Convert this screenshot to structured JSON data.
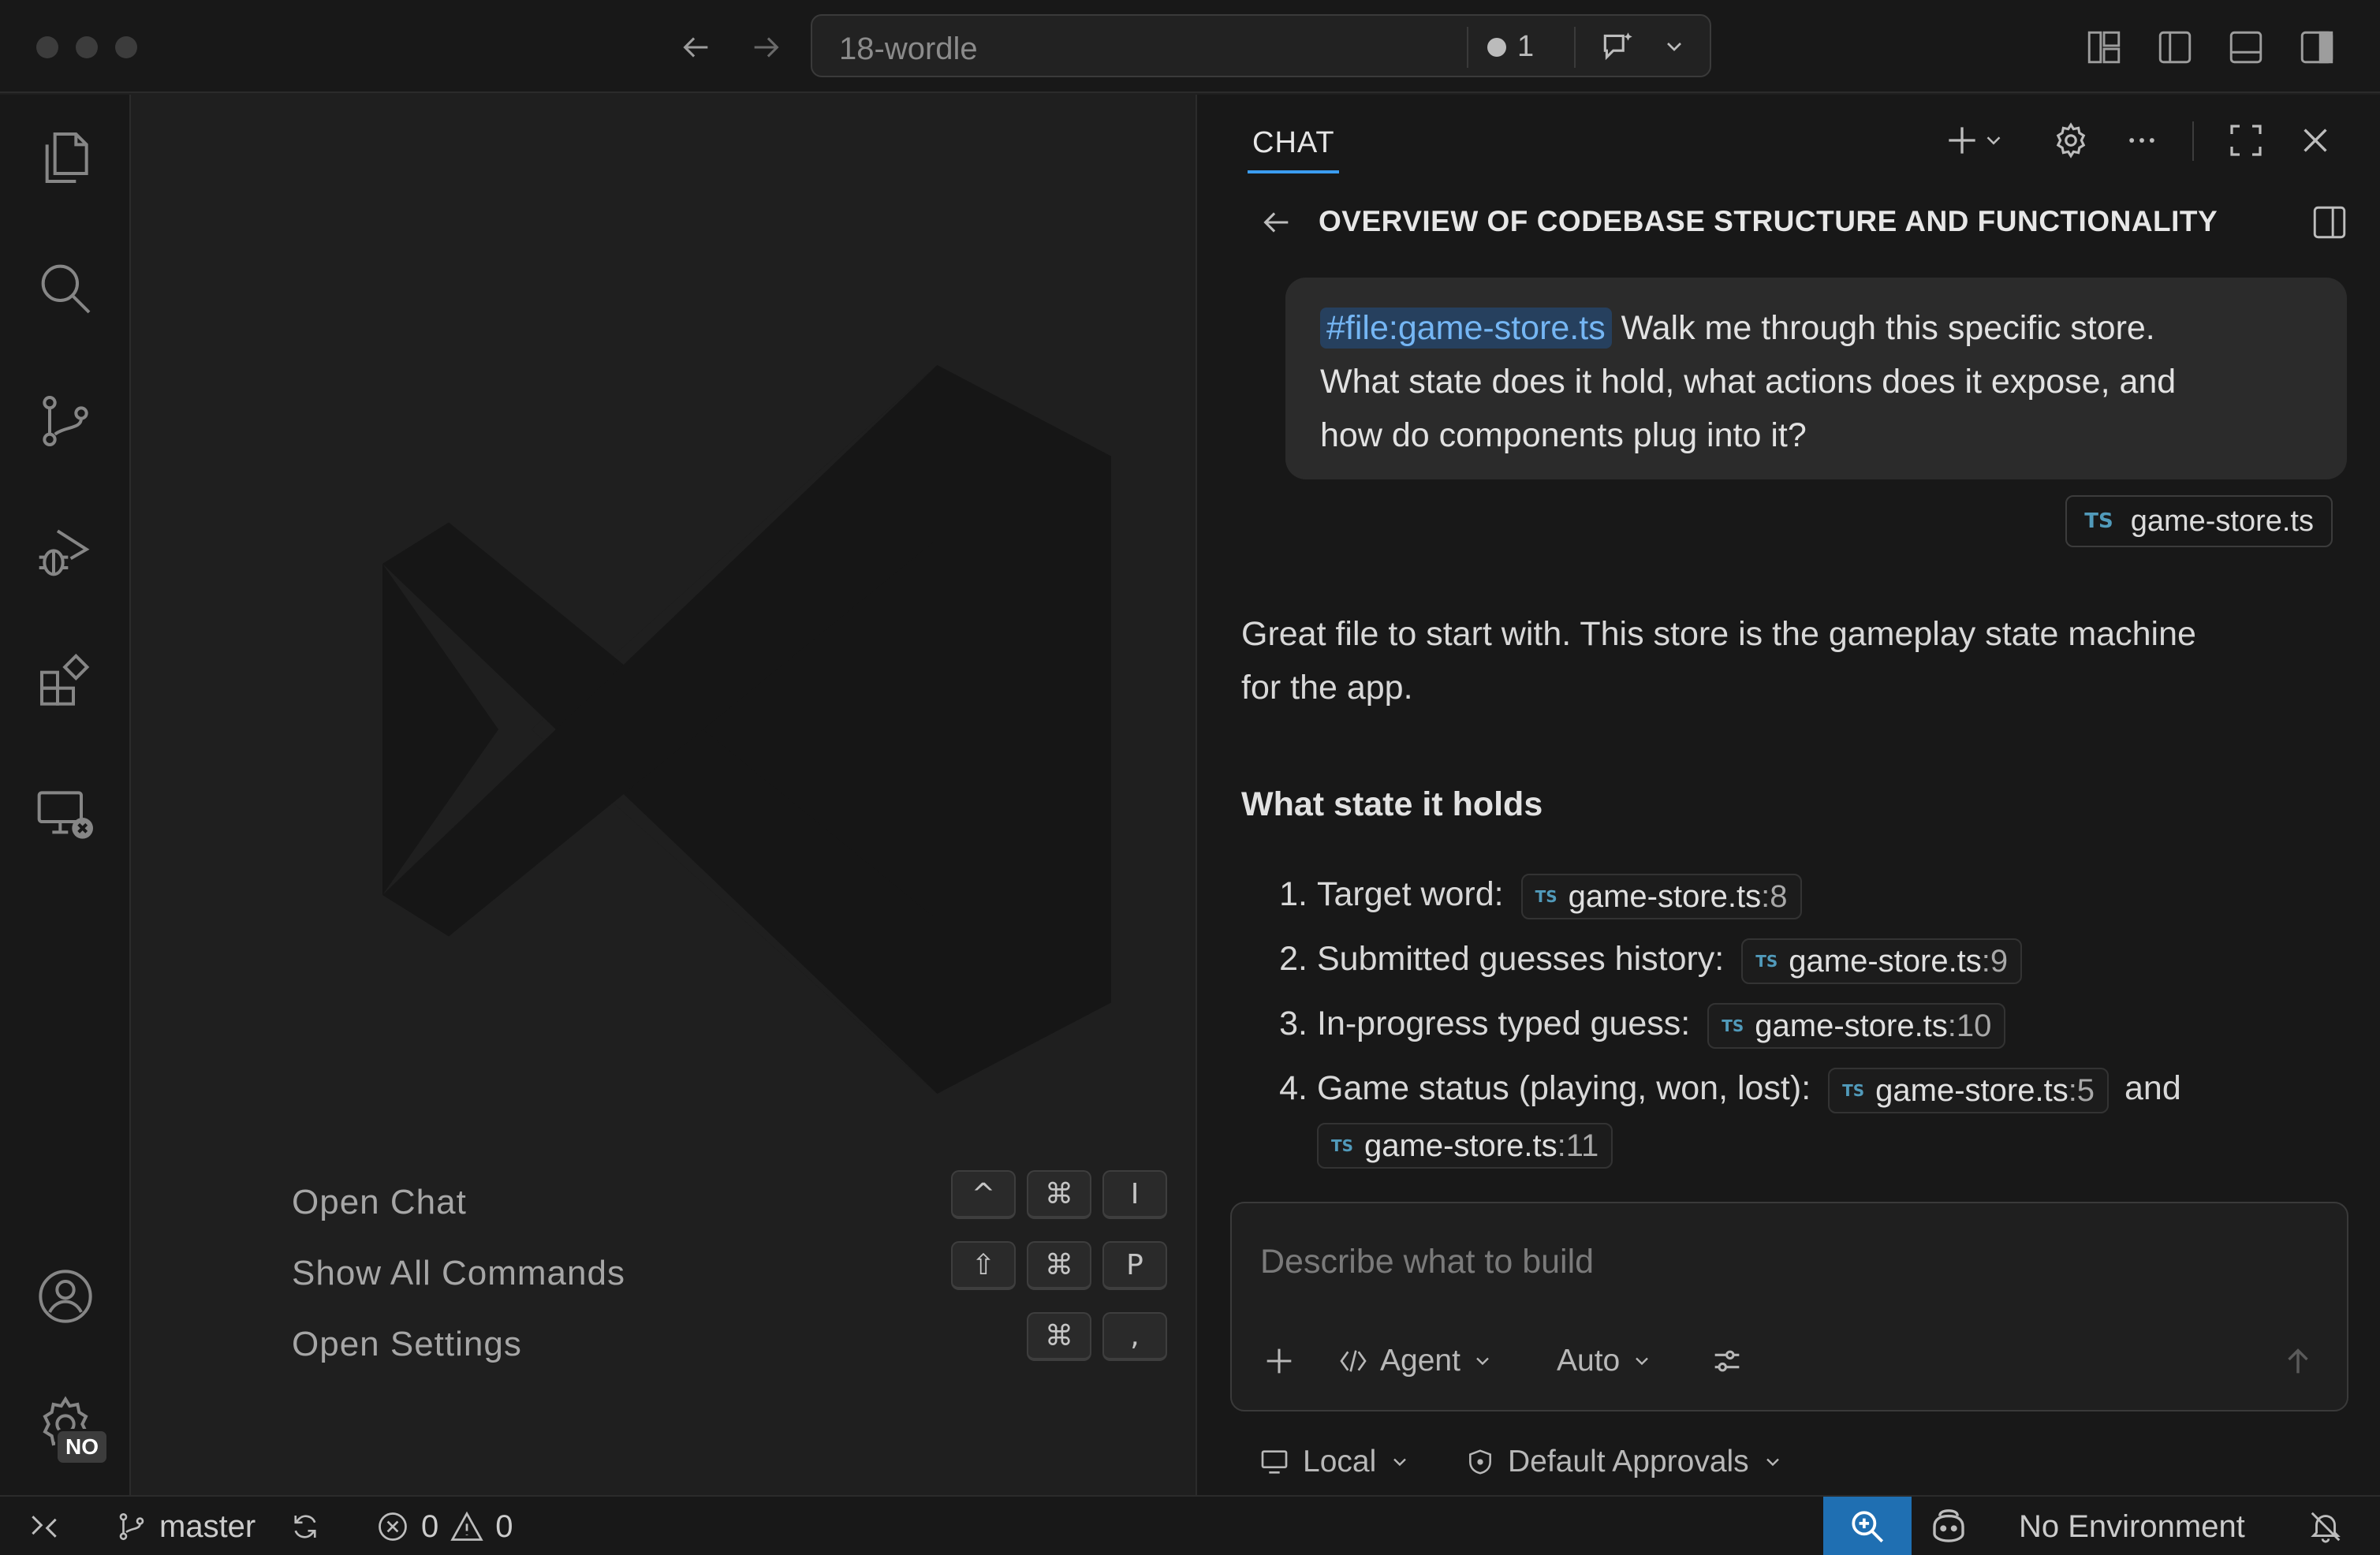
{
  "titlebar": {
    "search_title": "18-wordle",
    "problem_count": "1",
    "icons": [
      "back-arrow-icon",
      "forward-arrow-icon",
      "copilot-chat-icon",
      "chevron-down-icon",
      "customize-layout-icon",
      "toggle-primary-sidebar-icon",
      "toggle-panel-icon",
      "toggle-secondary-sidebar-icon"
    ]
  },
  "activitybar": {
    "items": [
      "explorer-icon",
      "search-icon",
      "source-control-icon",
      "run-debug-icon",
      "extensions-icon",
      "remote-explorer-icon"
    ],
    "bottom": [
      "accounts-icon",
      "manage-gear-icon"
    ],
    "manage_badge": "NO"
  },
  "welcome": {
    "shortcuts": [
      {
        "label": "Open Chat",
        "keys": [
          "^",
          "⌘",
          "I"
        ]
      },
      {
        "label": "Show All Commands",
        "keys": [
          "⇧",
          "⌘",
          "P"
        ]
      },
      {
        "label": "Open Settings",
        "keys": [
          "⌘",
          ","
        ]
      }
    ]
  },
  "chat": {
    "tab_label": "CHAT",
    "thread_title": "OVERVIEW OF CODEBASE STRUCTURE AND FUNCTIONALITY",
    "user_message": {
      "file_mention": "#file:game-store.ts",
      "text_line1": " Walk me through this specific store.",
      "text_line2": "What state does it hold, what actions does it expose, and",
      "text_line3": "how do components plug into it?"
    },
    "attachment": {
      "lang": "TS",
      "name": "game-store.ts"
    },
    "assistant": {
      "intro_line1": "Great file to start with. This store is the gameplay state machine",
      "intro_line2": "for the app.",
      "heading": "What state it holds",
      "items": [
        {
          "num": "1.",
          "text": "Target word:",
          "ref": {
            "file": "game-store.ts",
            "line": ":8"
          }
        },
        {
          "num": "2.",
          "text": "Submitted guesses history:",
          "ref": {
            "file": "game-store.ts",
            "line": ":9"
          }
        },
        {
          "num": "3.",
          "text": "In-progress typed guess:",
          "ref": {
            "file": "game-store.ts",
            "line": ":10"
          }
        },
        {
          "num": "4.",
          "text": "Game status (playing, won, lost):",
          "ref": {
            "file": "game-store.ts",
            "line": ":5"
          },
          "joiner": "and",
          "ref2": {
            "file": "game-store.ts",
            "line": ":11"
          }
        }
      ],
      "ts_tag": "TS"
    },
    "input": {
      "placeholder": "Describe what to build",
      "mode_label": "Agent",
      "model_label": "Auto"
    },
    "footer": {
      "location_label": "Local",
      "approvals_label": "Default Approvals"
    }
  },
  "statusbar": {
    "branch": "master",
    "errors": "0",
    "warnings": "0",
    "environment": "No Environment"
  },
  "colors": {
    "accent": "#3b9cf0",
    "zoom_bg": "#1f6fb2",
    "mention_bg": "#26405e",
    "ts_blue": "#519aba"
  }
}
